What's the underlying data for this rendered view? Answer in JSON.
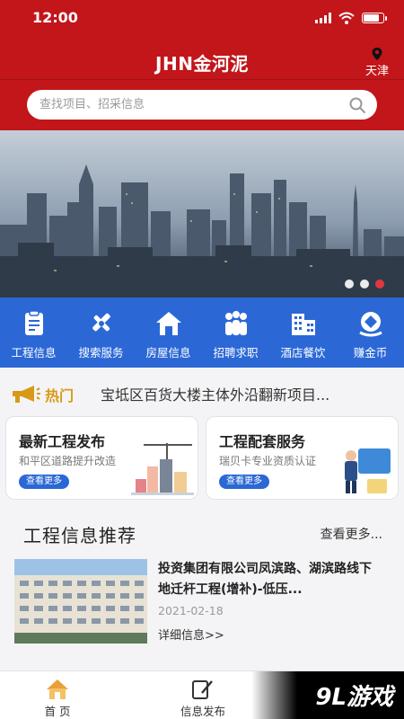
{
  "status": {
    "time": "12:00"
  },
  "header": {
    "title": "JHN金河泥",
    "city": "天津"
  },
  "search": {
    "placeholder": "查找项目、招采信息"
  },
  "banner": {
    "slides": 3,
    "active_slide": 3
  },
  "menu": [
    {
      "label": "工程信息",
      "icon": "clipboard-icon"
    },
    {
      "label": "搜索服务",
      "icon": "tools-icon"
    },
    {
      "label": "房屋信息",
      "icon": "house-icon"
    },
    {
      "label": "招聘求职",
      "icon": "people-icon"
    },
    {
      "label": "酒店餐饮",
      "icon": "building-icon"
    },
    {
      "label": "赚金币",
      "icon": "coin-icon"
    }
  ],
  "news": {
    "label": "热门",
    "text": "宝坻区百货大楼主体外沿翻新项目..."
  },
  "cards": [
    {
      "title": "最新工程发布",
      "subtitle": "和平区道路提升改造",
      "button": "查看更多"
    },
    {
      "title": "工程配套服务",
      "subtitle": "瑞贝卡专业资质认证",
      "button": "查看更多"
    }
  ],
  "section": {
    "title": "工程信息推荐",
    "more": "查看更多..."
  },
  "article": {
    "title": "投资集团有限公司凤滨路、湖滨路线下地迁杆工程(增补)-低压...",
    "date": "2021-02-18",
    "more": "详细信息>>"
  },
  "tabbar": [
    {
      "label": "首 页",
      "icon": "home-icon"
    },
    {
      "label": "信息发布",
      "icon": "edit-icon"
    }
  ],
  "watermark": {
    "text": "9L游戏"
  },
  "colors": {
    "brand_red": "#c2161b",
    "menu_blue": "#2b68d6",
    "hot_gold": "#d89a16"
  }
}
